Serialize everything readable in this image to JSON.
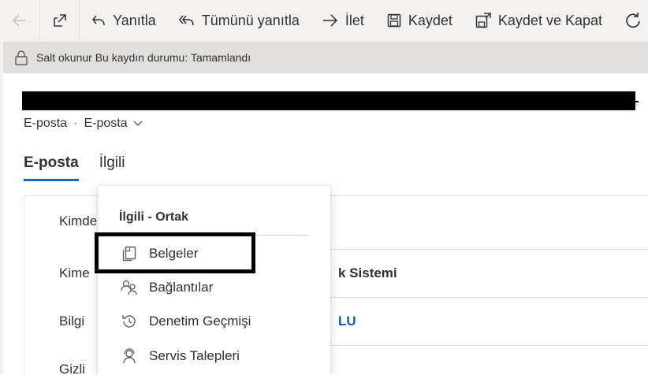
{
  "toolbar": {
    "reply": "Yanıtla",
    "reply_all": "Tümünü yanıtla",
    "forward": "İlet",
    "save": "Kaydet",
    "save_close": "Kaydet ve Kapat"
  },
  "infobar": {
    "text": "Salt okunur Bu kaydın durumu: Tamamlandı"
  },
  "breadcrumb": {
    "entity": "E-posta",
    "separator": "·",
    "form": "E-posta"
  },
  "tabs": [
    {
      "label": "E-posta",
      "active": true
    },
    {
      "label": "İlgili",
      "active": false
    }
  ],
  "form": {
    "rows": [
      {
        "label": "Kimde",
        "value": ""
      },
      {
        "label": "Kime",
        "value": "k Sistemi"
      },
      {
        "label": "Bilgi",
        "value": "LU"
      },
      {
        "label": "Gizli",
        "value": ""
      }
    ]
  },
  "menu": {
    "header": "İlgili - Ortak",
    "items": [
      {
        "label": "Belgeler",
        "icon": "document-icon"
      },
      {
        "label": "Bağlantılar",
        "icon": "contacts-icon"
      },
      {
        "label": "Denetim Geçmişi",
        "icon": "history-icon"
      },
      {
        "label": "Servis Talepleri",
        "icon": "headset-icon"
      }
    ]
  },
  "colors": {
    "accent": "#0f6cbd",
    "link": "#0f5ea8",
    "background": "#f3f2f1"
  }
}
